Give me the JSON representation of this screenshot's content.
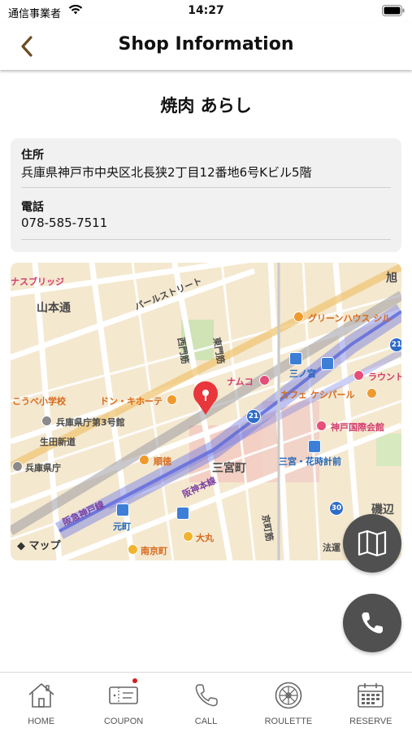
{
  "status_bar": {
    "carrier": "通信事業者",
    "time": "14:27"
  },
  "nav": {
    "title": "Shop Information"
  },
  "shop": {
    "name": "焼肉 あらし",
    "address_label": "住所",
    "address": "兵庫県神戸市中央区北長狭2丁目12番地6号Kビル5階",
    "phone_label": "電話",
    "phone": "078-585-7511"
  },
  "map": {
    "attribution": "マップ",
    "labels": {
      "bridge": "ナスブリッジ",
      "yamamoto": "山本通",
      "pearl": "パールストリート",
      "asahi": "旭",
      "greenhouse": "グリーンハウス シル",
      "nishimon": "西門筋",
      "higashimon": "東門筋",
      "sannomiya_station": "三ノ宮",
      "round1": "ラウント",
      "namco": "ナムコ",
      "cafe": "カフェ ケシパール",
      "kobe_school": "こうべ小学校",
      "donki": "ドン・キホーテ",
      "kencho3": "兵庫県庁第3号館",
      "ikuta": "生田新道",
      "kokusai": "神戸国際会館",
      "juntoku": "順徳",
      "sannomiyacho": "三宮町",
      "hanadokei": "三宮・花時計前",
      "kencho": "兵庫県庁",
      "hanshin": "阪神本線",
      "hankyu": "阪急神戸線",
      "motomachi": "元町",
      "kyomachi": "京町筋",
      "isogami": "磯辺",
      "daimaru": "大丸",
      "nankinmachi": "南京町",
      "houkou": "法運",
      "route21": "21",
      "route30": "30"
    }
  },
  "tabs": [
    {
      "label": "HOME",
      "icon": "home-icon"
    },
    {
      "label": "COUPON",
      "icon": "coupon-icon"
    },
    {
      "label": "CALL",
      "icon": "phone-icon"
    },
    {
      "label": "ROULETTE",
      "icon": "roulette-icon"
    },
    {
      "label": "RESERVE",
      "icon": "calendar-icon"
    }
  ],
  "colors": {
    "pin": "#e8363c",
    "fab": "#505050",
    "badge": "#d61d1d",
    "back_arrow": "#6b4c21"
  }
}
